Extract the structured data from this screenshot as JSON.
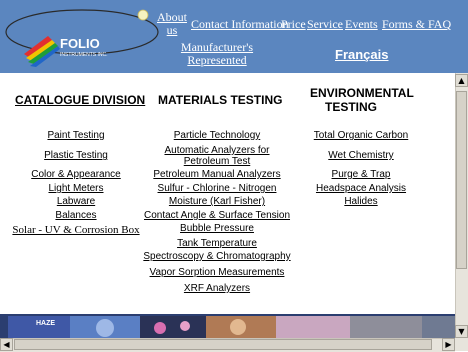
{
  "logo": {
    "name": "FOLIO",
    "subtitle": "INSTRUMENTS INC."
  },
  "nav": {
    "about": "About us",
    "contact": "Contact Information",
    "price": "Price",
    "service": "Service",
    "events": "Events",
    "forms": "Forms & FAQ",
    "manufacturers": "Manufacturer's Represented",
    "language": "Français"
  },
  "headings": {
    "catalogue": "CATALOGUE DIVISION",
    "materials": "MATERIALS TESTING",
    "environmental": "ENVIRONMENTAL TESTING"
  },
  "catalogue_items": [
    "Paint Testing",
    "Plastic Testing",
    "Color & Appearance",
    "Light Meters",
    "Labware",
    "Balances",
    "Solar - UV & Corrosion Box"
  ],
  "materials_items": [
    "Particle Technology",
    "Automatic Analyzers for Petroleum Test",
    "Petroleum Manual Analyzers",
    "Sulfur - Chlorine - Nitrogen",
    "Moisture (Karl Fisher)",
    "Contact Angle & Surface Tension",
    "Bubble Pressure",
    "Tank Temperature",
    "Spectroscopy & Chromatography",
    "Vapor Sorption Measurements",
    "XRF Analyzers"
  ],
  "environmental_items": [
    "Total Organic Carbon",
    "Wet Chemistry",
    "Purge & Trap",
    "Headspace Analysis",
    "Halides"
  ],
  "banner": {
    "label": "HAZE"
  },
  "colors": {
    "header_bg": "#5b86bf",
    "link_white": "#ffffff",
    "text": "#000000"
  }
}
